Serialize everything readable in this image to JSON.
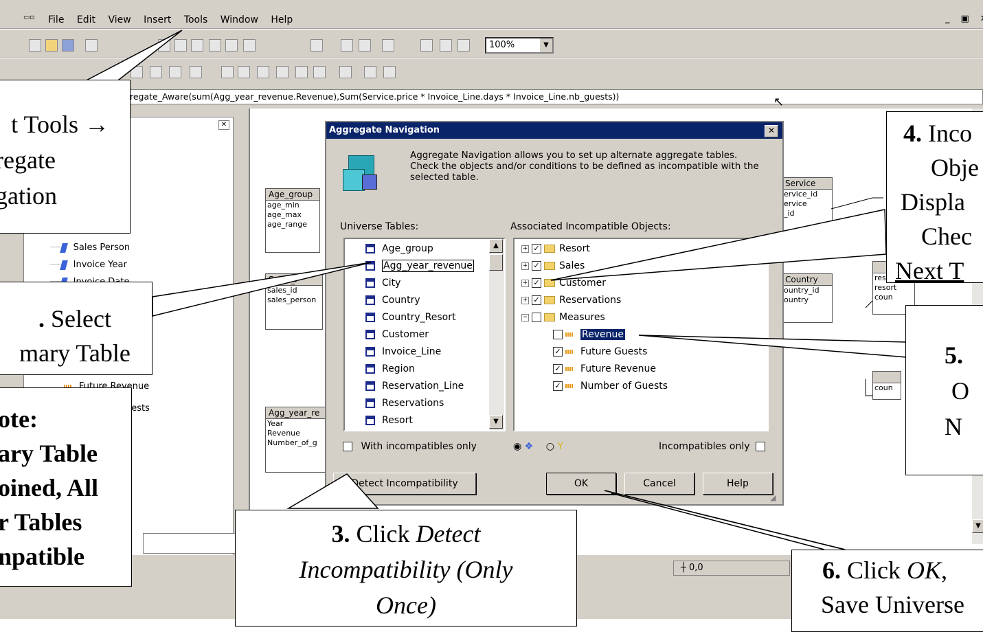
{
  "menu": [
    "File",
    "Edit",
    "View",
    "Insert",
    "Tools",
    "Window",
    "Help"
  ],
  "zoom": "100%",
  "formula": "regate_Aware(sum(Agg_year_revenue.Revenue),Sum(Service.price * Invoice_Line.days  * Invoice_Line.nb_guests))",
  "left_tree": {
    "items": [
      "Sales Person",
      "Invoice Year",
      "Invoice Date"
    ],
    "partial_items": [
      "Future Revenue",
      "uests"
    ]
  },
  "tables": {
    "age_group": {
      "title": "Age_group",
      "rows": [
        "age_min",
        "age_max",
        "age_range"
      ]
    },
    "sales_person": {
      "title": "Sales_P",
      "rows": [
        "sales_id",
        "sales_person"
      ]
    },
    "agg_year": {
      "title": "Agg_year_re",
      "rows": [
        "Year",
        "Revenue",
        "Number_of_g"
      ]
    },
    "service": {
      "title": "Service",
      "rows": [
        "ervice_id",
        "ervice",
        "_id"
      ]
    },
    "country": {
      "title": "Country",
      "rows": [
        "ountry_id",
        "ountry"
      ]
    },
    "resort_partial": {
      "rows": [
        "resort_id",
        "resort",
        "coun"
      ]
    },
    "partial2": {
      "rows": [
        "coun"
      ]
    }
  },
  "dialog": {
    "title": "Aggregate Navigation",
    "description": "Aggregate Navigation allows you to set up alternate aggregate tables.\nCheck the objects and/or conditions to be defined as incompatible with the selected table.",
    "universe_label": "Universe Tables:",
    "incompatible_label": "Associated Incompatible Objects:",
    "universe_tables": [
      "Age_group",
      "Agg_year_revenue",
      "City",
      "Country",
      "Country_Resort",
      "Customer",
      "Invoice_Line",
      "Region",
      "Reservation_Line",
      "Reservations",
      "Resort"
    ],
    "selected_table": "Agg_year_revenue",
    "classes": [
      {
        "name": "Resort",
        "checked": true
      },
      {
        "name": "Sales",
        "checked": true
      },
      {
        "name": "Customer",
        "checked": true
      },
      {
        "name": "Reservations",
        "checked": true
      },
      {
        "name": "Measures",
        "checked": false
      }
    ],
    "measures": [
      {
        "name": "Revenue",
        "checked": false
      },
      {
        "name": "Future Guests",
        "checked": true
      },
      {
        "name": "Future Revenue",
        "checked": true
      },
      {
        "name": "Number of Guests",
        "checked": true
      }
    ],
    "with_incompatibles_only": "With incompatibles only",
    "incompatibles_only": "Incompatibles only",
    "detect_button": "Detect Incompatibility",
    "ok_button": "OK",
    "cancel_button": "Cancel",
    "help_button": "Help"
  },
  "status": {
    "coords": "0,0"
  },
  "callouts": {
    "c1": {
      "line1": "t Tools →",
      "line2": "regate",
      "line3": "gation"
    },
    "c2": {
      "num": ".",
      "text1": " Select",
      "text2": "mary Table"
    },
    "note": {
      "l1": "ote:",
      "l2": "ary Table",
      "l3": "oined, All",
      "l4": "r Tables",
      "l5": "npatible"
    },
    "c3": {
      "num": "3.",
      "text1": " Click ",
      "em1": "Detect",
      "l2": "Incompatibility (Only",
      "l3": "Once)"
    },
    "c4": {
      "num": "4.",
      "t1": " Inco",
      "l2": "Obje",
      "l3": "Displa",
      "l4": "Chec",
      "l5": "Next T"
    },
    "c5": {
      "num": "5.",
      "l2": "O",
      "l3": "N"
    },
    "c6": {
      "num": "6.",
      "t1": " Click ",
      "em1": "OK",
      "t2": ",",
      "l2": "Save Universe"
    }
  }
}
